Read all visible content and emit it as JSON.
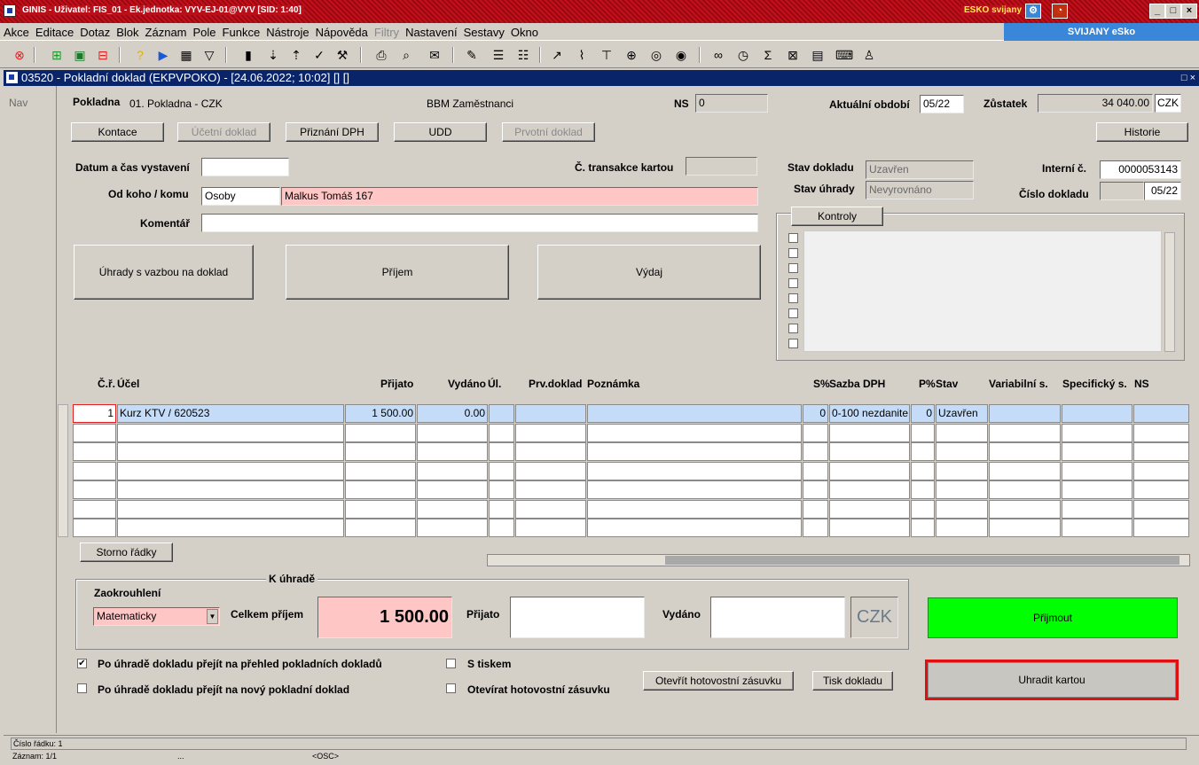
{
  "titlebar": {
    "title": "GINIS - Uživatel: FIS_01 - Ek.jednotka: VYV-EJ-01@VYV   [SID: 1:40]",
    "esko": "ESKO svijany"
  },
  "menu": [
    "Akce",
    "Editace",
    "Dotaz",
    "Blok",
    "Záznam",
    "Pole",
    "Funkce",
    "Nástroje",
    "Nápověda",
    "Filtry",
    "Nastavení",
    "Sestavy",
    "Okno"
  ],
  "menu_disabled": "Filtry",
  "svijany": "SVIJANY eSko",
  "form": {
    "title": "03520 - Pokladní doklad (EKPVPOKO) - [24.06.2022; 10:02]  []  []",
    "close": "□ ×"
  },
  "nav": "Nav",
  "header": {
    "pokladna_label": "Pokladna",
    "pokladna_value": "01. Pokladna - CZK",
    "bbm": "BBM Zaměstnanci",
    "ns_label": "NS",
    "ns_value": "0",
    "obdobi_label": "Aktuální období",
    "obdobi_value": "05/22",
    "zustatek_label": "Zůstatek",
    "zustatek_value": "34 040.00",
    "zustatek_cur": "CZK"
  },
  "buttons": {
    "kontace": "Kontace",
    "ucetni": "Účetní doklad",
    "priznani": "Přiznání DPH",
    "udd": "UDD",
    "prvotni": "Prvotní doklad",
    "historie": "Historie",
    "uhrady": "Úhrady s vazbou na doklad",
    "prijem": "Příjem",
    "vydaj": "Výdaj",
    "kontroly": "Kontroly",
    "storno": "Storno řádky",
    "prijmout": "Přijmout",
    "uhradit": "Uhradit kartou",
    "otevrit": "Otevřít hotovostní zásuvku",
    "tisk": "Tisk dokladu"
  },
  "fields": {
    "datum_label": "Datum a čas vystavení",
    "datum_value": "",
    "transakce_label": "Č. transakce kartou",
    "transakce_value": "",
    "odkoho_label": "Od koho / komu",
    "odkoho_type": "Osoby",
    "odkoho_value": "Malkus Tomáš 167",
    "komentar_label": "Komentář",
    "komentar_value": "",
    "stav_dokladu_label": "Stav dokladu",
    "stav_dokladu_value": "Uzavřen",
    "stav_uhrady_label": "Stav úhrady",
    "stav_uhrady_value": "Nevyrovnáno",
    "interni_label": "Interní č.",
    "interni_value": "0000053143",
    "cislo_label": "Číslo dokladu",
    "cislo_value": "05/22"
  },
  "table": {
    "headers": {
      "cr": "Č.ř.",
      "ucel": "Účel",
      "prijato": "Přijato",
      "vydano": "Vydáno",
      "ul": "Úl.",
      "prv": "Prv.doklad",
      "pozn": "Poznámka",
      "sp": "S%",
      "sazba": "Sazba DPH",
      "pp": "P%",
      "stav": "Stav",
      "var": "Variabilní s.",
      "spec": "Specifický s.",
      "ns": "NS"
    },
    "row": {
      "cr": "1",
      "ucel": "Kurz KTV / 620523",
      "prijato": "1 500.00",
      "vydano": "0.00",
      "sp": "0",
      "sazba": "0-100 nezdanite",
      "pp": "0",
      "stav": "Uzavřen"
    }
  },
  "bottom": {
    "k_uhrade": "K úhradě",
    "zaokrouhleni_label": "Zaokrouhlení",
    "zaokrouhleni_value": "Matematicky",
    "celkem_label": "Celkem příjem",
    "celkem_value": "1 500.00",
    "prijato_label": "Přijato",
    "prijato_value": "",
    "vydano_label": "Vydáno",
    "vydano_value": "",
    "currency": "CZK",
    "chk1": "Po úhradě dokladu přejít na přehled pokladních dokladů",
    "chk1_checked": "✔",
    "chk2": "Po úhradě dokladu přejít na nový pokladní doklad",
    "chk3": "S tiskem",
    "chk4": "Otevírat hotovostní zásuvku"
  },
  "status": {
    "radek": "Číslo řádku: 1",
    "zaznam": "Záznam: 1/1",
    "dots": "...",
    "osc": "<OSC>"
  },
  "colors": {
    "titlebar": "#b8101a",
    "selected": "#c4dcf8",
    "pink": "#ffc6c6",
    "green": "#00ff00",
    "highlight": "#e01010"
  }
}
